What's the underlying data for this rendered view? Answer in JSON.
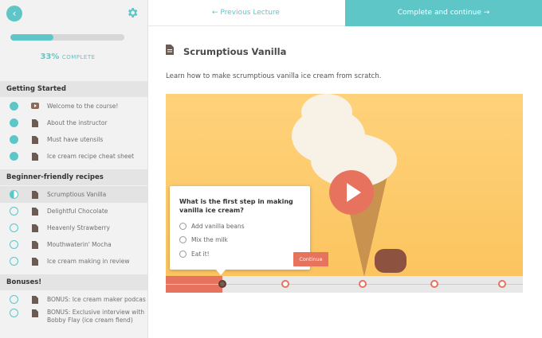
{
  "sidebar": {
    "progress_value": 0.33,
    "progress_percent": "33%",
    "progress_caption": "COMPLETE",
    "sections": [
      {
        "title": "Getting Started",
        "items": [
          {
            "label": "Welcome to the course!",
            "status": "done",
            "type": "video"
          },
          {
            "label": "About the instructor",
            "status": "done",
            "type": "text"
          },
          {
            "label": "Must have utensils",
            "status": "done",
            "type": "text"
          },
          {
            "label": "Ice cream recipe cheat sheet",
            "status": "done",
            "type": "text"
          }
        ]
      },
      {
        "title": "Beginner-friendly recipes",
        "items": [
          {
            "label": "Scrumptious Vanilla",
            "status": "in-progress",
            "type": "text"
          },
          {
            "label": "Delightful Chocolate",
            "status": "todo",
            "type": "text"
          },
          {
            "label": "Heavenly Strawberry",
            "status": "todo",
            "type": "text"
          },
          {
            "label": "Mouthwaterin' Mocha",
            "status": "todo",
            "type": "text"
          },
          {
            "label": "Ice cream making in review",
            "status": "todo",
            "type": "text"
          }
        ]
      },
      {
        "title": "Bonuses!",
        "items": [
          {
            "label": "BONUS: Ice cream maker podcast",
            "status": "todo",
            "type": "text"
          },
          {
            "label": "BONUS: Exclusive interview with Bobby Flay (ice cream fiend)",
            "status": "todo",
            "type": "text"
          }
        ]
      }
    ]
  },
  "topbar": {
    "prev_label": "Previous Lecture",
    "complete_label": "Complete and continue"
  },
  "lecture": {
    "title": "Scrumptious Vanilla",
    "description": "Learn how to make scrumptious vanilla ice cream from scratch."
  },
  "quiz": {
    "question": "What is the first step in making vanilla ice cream?",
    "options": [
      "Add vanilla beans",
      "Mix the milk",
      "Eat it!"
    ],
    "continue_label": "Continue"
  },
  "video": {
    "progress_fraction": 0.158
  },
  "colors": {
    "accent": "#5fc6c8",
    "cta": "#e7735f"
  }
}
